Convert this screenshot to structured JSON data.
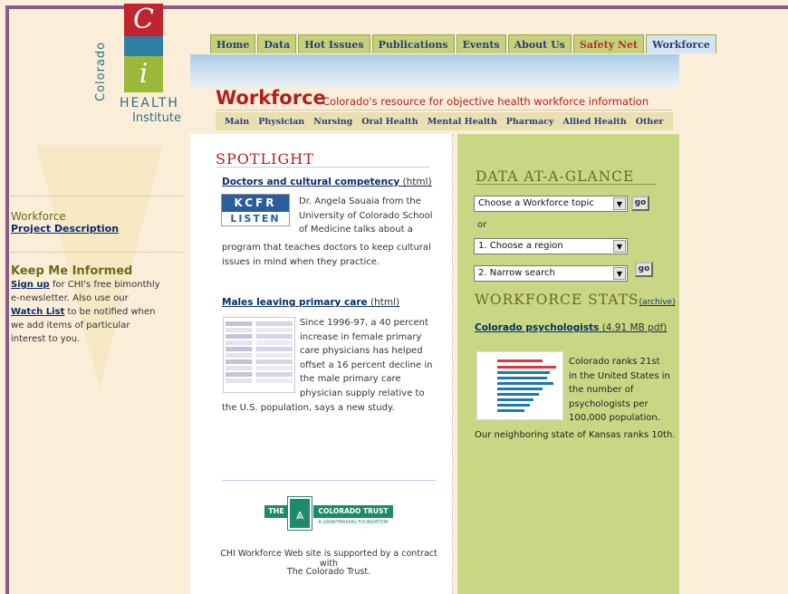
{
  "logo": {
    "vertical": "Colorado",
    "c": "C",
    "i": "i",
    "health": "HEALTH",
    "institute": "Institute"
  },
  "sidebar": {
    "section_title": "Workforce",
    "project_link": "Project Description",
    "keep_title": "Keep Me Informed",
    "signup_link": "Sign up",
    "signup_text_1": " for CHI's free bimonthly",
    "signup_text_2": "e-newsletter. Also use our",
    "watch_link": "Watch List",
    "watch_text_1": " to be notified when",
    "watch_text_2": "we add items of particular",
    "watch_text_3": "interest to you."
  },
  "nav": {
    "tabs": [
      "Home",
      "Data",
      "Hot Issues",
      "Publications",
      "Events",
      "About Us",
      "Safety Net",
      "Workforce"
    ]
  },
  "header": {
    "title": "Workforce",
    "subtitle": "Colorado's resource for objective health workforce information",
    "subnav": [
      "Main",
      "Physician",
      "Nursing",
      "Oral Health",
      "Mental Health",
      "Pharmacy",
      "Allied Health",
      "Other"
    ]
  },
  "spotlight": {
    "heading": "SPOTLIGHT",
    "article1": {
      "link": "Doctors and cultural competency",
      "format": " (html)",
      "badge_top": "KCFR",
      "badge_bottom": "LISTEN",
      "lines": [
        "Dr. Angela Sauaia from the",
        "University of Colorado School",
        "of Medicine talks about a"
      ],
      "lines_full": [
        "program that teaches doctors to keep cultural",
        "issues in mind when they practice."
      ]
    },
    "article2": {
      "link": "Males leaving primary care",
      "format": " (html)",
      "lines": [
        "Since 1996-97, a 40 percent",
        "increase in female primary",
        "care physicians has helped",
        "offset a 16 percent decline in",
        "the male primary care",
        "physician supply relative to"
      ],
      "lines_full": [
        "the U.S. population, says a new study."
      ]
    },
    "trust": {
      "the": "THE",
      "logo": "⩓",
      "name": "COLORADO TRUST",
      "sub": "A GRANTMAKING FOUNDATION"
    },
    "footer_1": "CHI Workforce Web site is supported by a contract with",
    "footer_2": "The Colorado Trust."
  },
  "data_glance": {
    "heading": "DATA AT-A-GLANCE",
    "topic_select": "Choose a Workforce topic",
    "go": "go",
    "or": "or",
    "region_select": "1. Choose a region",
    "narrow_select": "2. Narrow search"
  },
  "stats": {
    "heading": "WORKFORCE STATS",
    "archive": "(archive)",
    "link": "Colorado psychologists",
    "format": " (4.91 MB pdf)",
    "lines": [
      "Colorado ranks 21st",
      "in the United States in",
      "the number of",
      "psychologists per",
      "100,000 population."
    ],
    "last_line": "Our neighboring state of Kansas ranks 10th.",
    "arrow": "▼"
  },
  "colors": {
    "accent_red": "#b51d1d",
    "nav_blue": "#2a3f7a",
    "right_panel": "#c9d784",
    "frame": "#8a5c88"
  }
}
